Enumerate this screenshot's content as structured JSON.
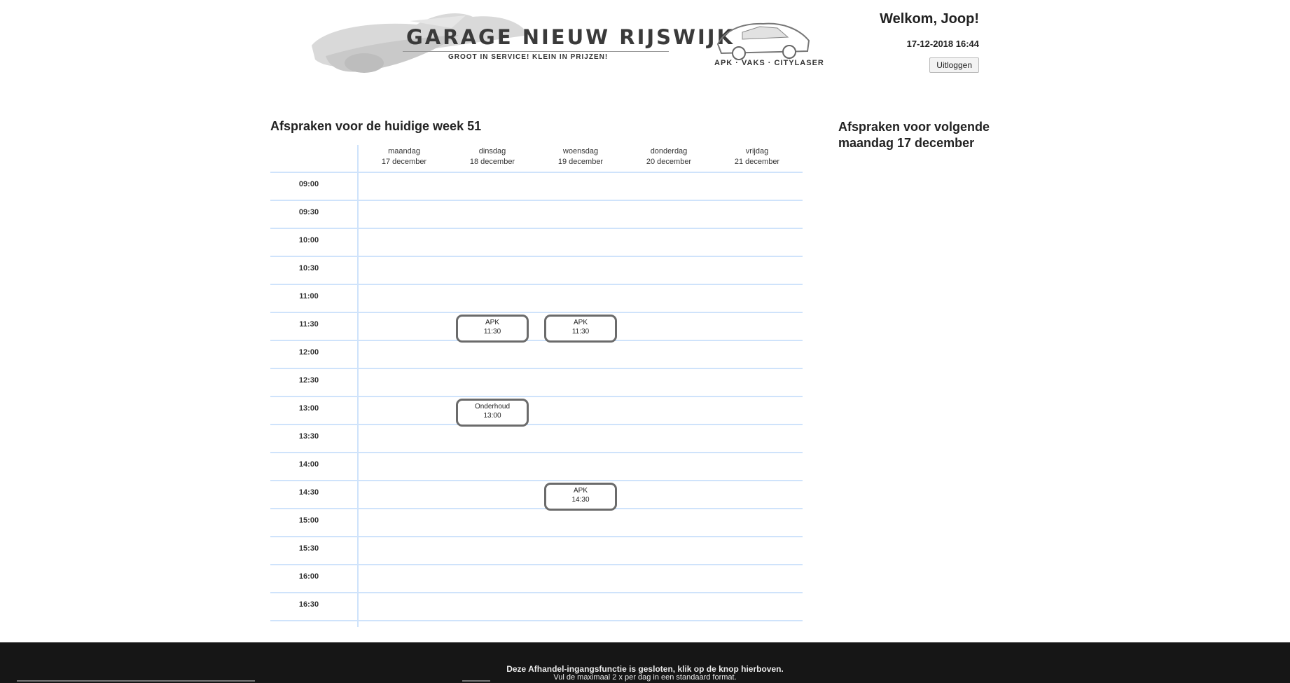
{
  "brand": {
    "title": "GARAGE NIEUW RIJSWIJK",
    "subtitle": "GROOT IN SERVICE! KLEIN IN PRIJZEN!",
    "right_caption": "APK · VAKS · CITYLASER"
  },
  "user": {
    "welcome": "Welkom, Joop!",
    "datetime": "17-12-2018 16:44",
    "logout_label": "Uitloggen"
  },
  "schedule": {
    "title": "Afspraken voor de huidige week 51",
    "days": [
      {
        "name": "maandag",
        "date": "17 december"
      },
      {
        "name": "dinsdag",
        "date": "18 december"
      },
      {
        "name": "woensdag",
        "date": "19 december"
      },
      {
        "name": "donderdag",
        "date": "20 december"
      },
      {
        "name": "vrijdag",
        "date": "21 december"
      }
    ],
    "times": [
      "09:00",
      "09:30",
      "10:00",
      "10:30",
      "11:00",
      "11:30",
      "12:00",
      "12:30",
      "13:00",
      "13:30",
      "14:00",
      "14:30",
      "15:00",
      "15:30",
      "16:00",
      "16:30"
    ],
    "appointments": [
      {
        "day": 1,
        "time": "11:30",
        "line1": "APK",
        "line2": "11:30"
      },
      {
        "day": 2,
        "time": "11:30",
        "line1": "APK",
        "line2": "11:30"
      },
      {
        "day": 1,
        "time": "13:00",
        "line1": "Onderhoud",
        "line2": "13:00"
      },
      {
        "day": 2,
        "time": "14:30",
        "line1": "APK",
        "line2": "14:30"
      }
    ]
  },
  "next_day": {
    "title": "Afspraken voor volgende maandag 17 december"
  },
  "footer": {
    "line1": "Deze Afhandel-ingangsfunctie is gesloten, klik op de knop hierboven.",
    "line2": "Vul de maximaal 2 x per dag in een standaard format."
  }
}
